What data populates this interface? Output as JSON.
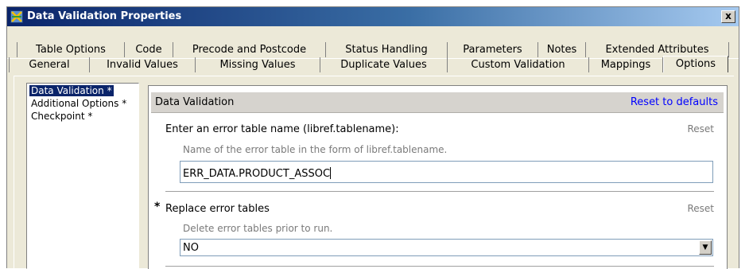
{
  "window": {
    "title": "Data Validation Properties",
    "close_glyph": "x",
    "icon": "data-validation-icon"
  },
  "tabs_row_back": [
    "Table Options",
    "Code",
    "Precode and Postcode",
    "Status Handling",
    "Parameters",
    "Notes",
    "Extended Attributes"
  ],
  "tabs_row_front": [
    "General",
    "Invalid Values",
    "Missing Values",
    "Duplicate Values",
    "Custom Validation",
    "Mappings",
    "Options"
  ],
  "active_tab": "Options",
  "sidebar": {
    "items": [
      {
        "label": "Data Validation",
        "marker": "*",
        "selected": true
      },
      {
        "label": "Additional Options",
        "marker": "*",
        "selected": false
      },
      {
        "label": "Checkpoint",
        "marker": "*",
        "selected": false
      }
    ]
  },
  "section": {
    "title": "Data Validation",
    "reset_defaults": "Reset to defaults"
  },
  "error_table": {
    "label": "Enter an error table name (libref.tablename):",
    "hint": "Name of the error table in the form of libref.tablename.",
    "value": "ERR_DATA.PRODUCT_ASSOC",
    "reset": "Reset"
  },
  "replace_tables": {
    "required_marker": "*",
    "label": "Replace error tables",
    "hint": "Delete error tables prior to run.",
    "value": "NO",
    "reset": "Reset"
  },
  "colors": {
    "title_start": "#0a246a",
    "title_end": "#a6caf0",
    "selection": "#0a246a",
    "link": "#0000ff",
    "face": "#ece9d8"
  }
}
